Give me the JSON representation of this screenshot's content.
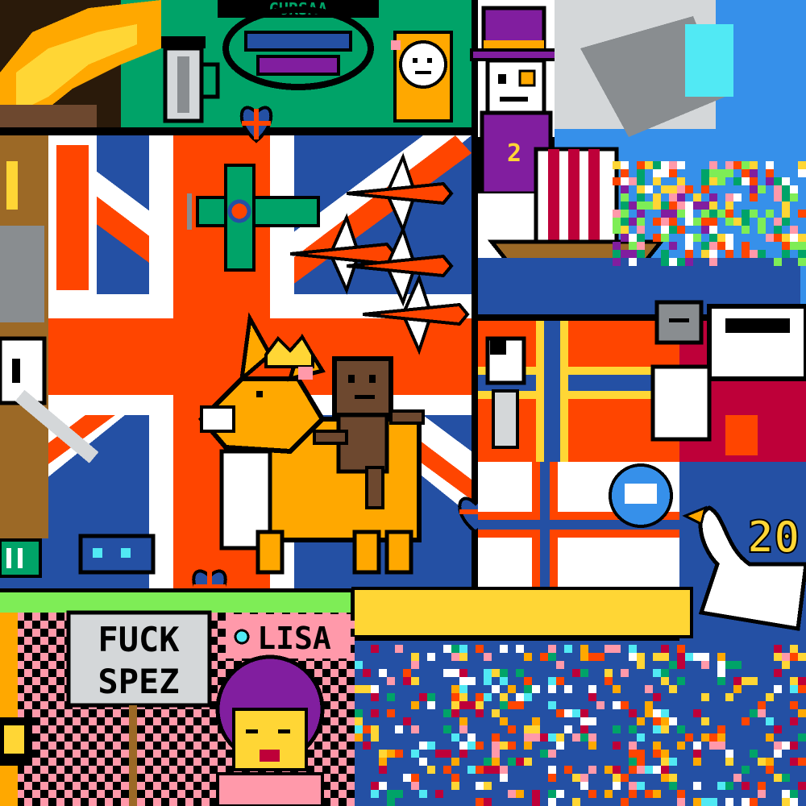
{
  "canvas": {
    "title": "",
    "colors": {
      "black": "#000000",
      "white": "#ffffff",
      "uk_red": "#ff4500",
      "uk_blue": "#2450a4",
      "green": "#00a368",
      "purple": "#811e9f",
      "orange": "#ffa800",
      "yellow": "#ffd635",
      "light_green": "#7eed56",
      "pink": "#ff99aa",
      "grey": "#898d90",
      "light_grey": "#d4d7d9",
      "brown": "#9c6926",
      "dark_brown": "#6d482f",
      "light_blue": "#51e9f4",
      "mid_blue": "#3690ea",
      "dark_red": "#be0039"
    }
  },
  "regions": {
    "union_jack": {
      "label": "union-jack-flag"
    },
    "corgi": {
      "label": "corgi-with-crown"
    },
    "sackboy": {
      "label": "sackboy-rider"
    },
    "top_hat_man": {
      "label": "top-hat-skeleton-man"
    },
    "viking_ship": {
      "label": "viking-ship"
    },
    "nordic_flag": {
      "label": "nordic-cross-flag"
    },
    "swan": {
      "label": "white-swan"
    },
    "big_ben": {
      "label": "big-ben-tower"
    },
    "french_press": {
      "label": "french-press"
    },
    "spitfire": {
      "label": "spitfire-plane"
    },
    "red_arrows": {
      "label": "red-arrows-jets"
    },
    "blue_noise": {
      "label": "noisy-blue-field"
    }
  },
  "texts": {
    "protest_sign": [
      "FUCK",
      "SPEZ"
    ],
    "name_sign": "LISA",
    "swan_number": "20",
    "top_banner": "GURSAA"
  }
}
